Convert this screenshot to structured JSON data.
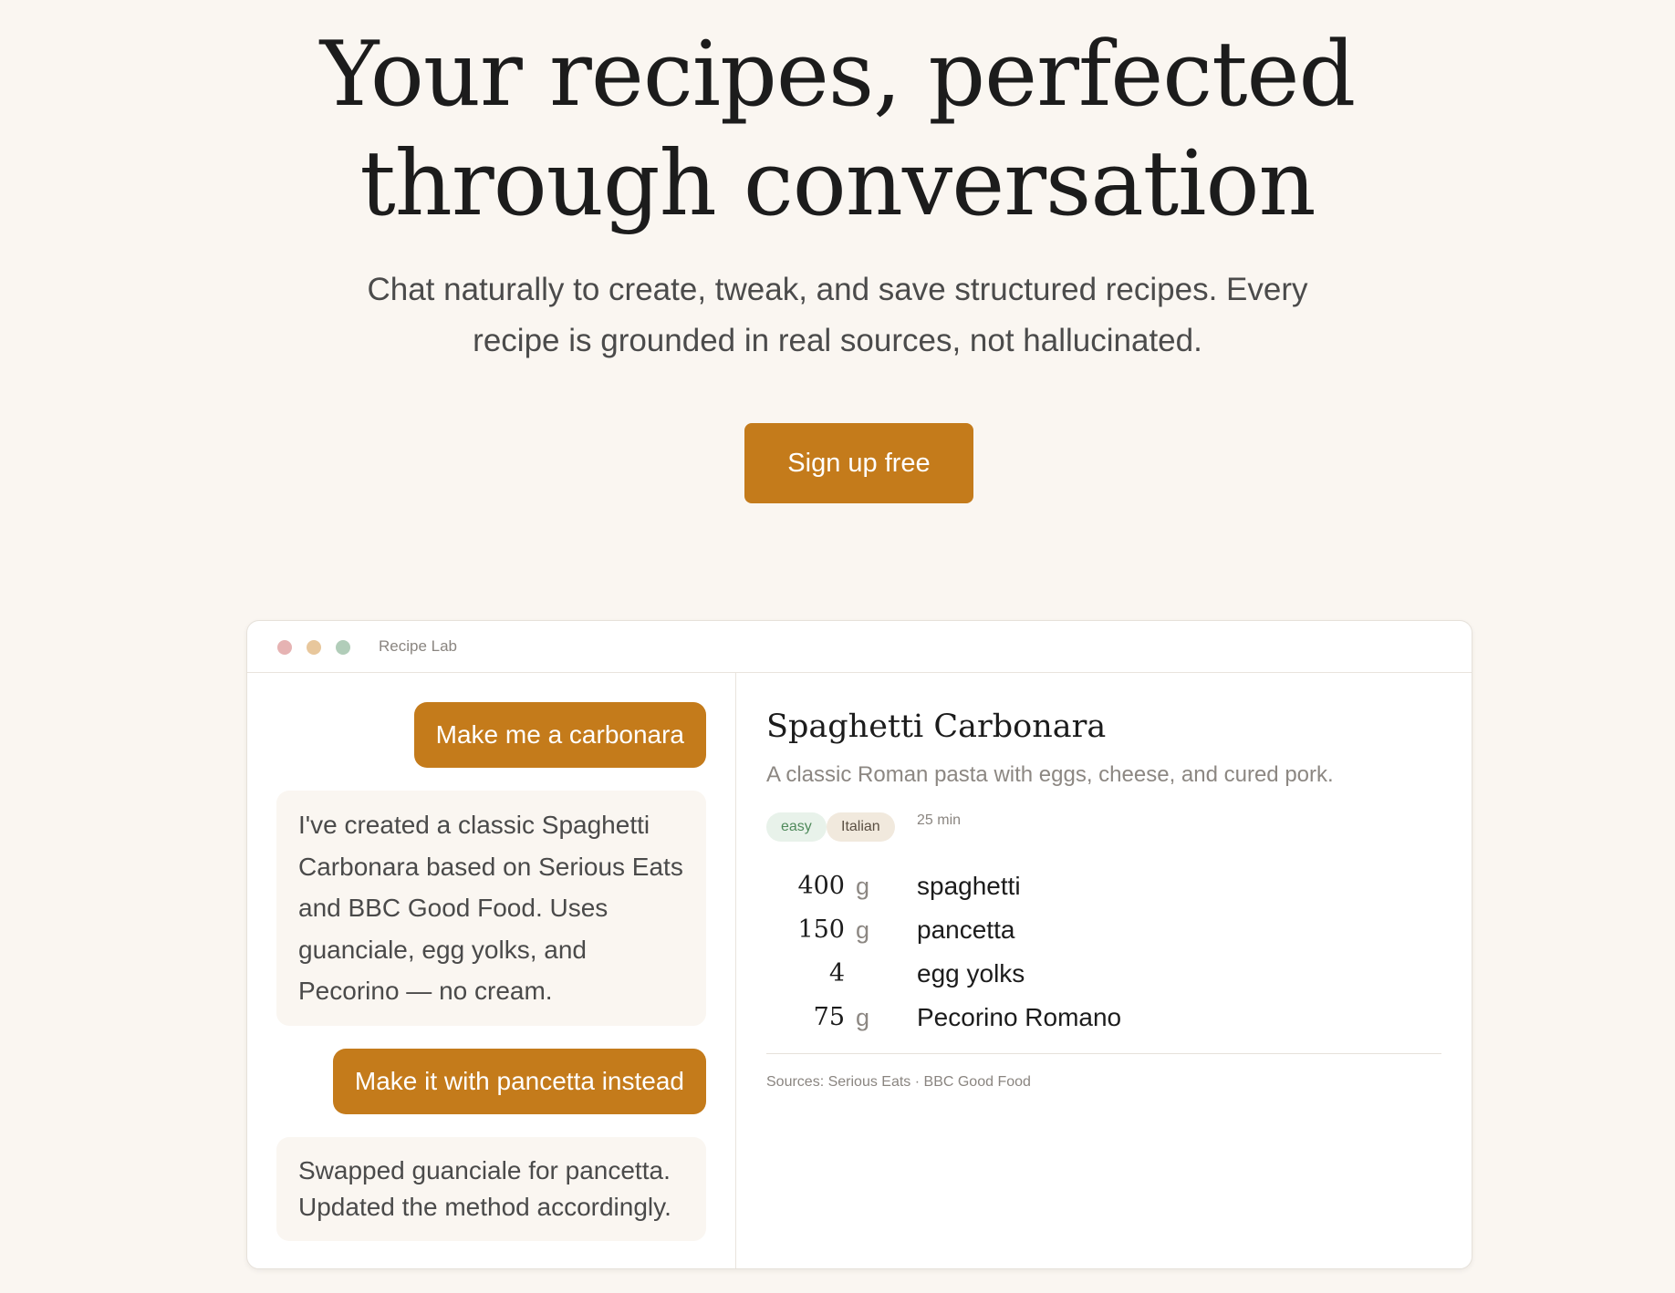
{
  "hero": {
    "title_line1": "Your recipes, perfected",
    "title_line2": "through conversation",
    "subtitle": "Chat naturally to create, tweak, and save structured recipes. Every recipe is grounded in real sources, not hallucinated.",
    "cta_label": "Sign up free"
  },
  "app": {
    "title": "Recipe Lab",
    "chat": [
      {
        "role": "user",
        "text": "Make me a carbonara"
      },
      {
        "role": "assistant",
        "text": "I've created a classic Spaghetti Carbonara based on Serious Eats and BBC Good Food. Uses guanciale, egg yolks, and Pecorino — no cream."
      },
      {
        "role": "user",
        "text": "Make it with pancetta instead"
      },
      {
        "role": "assistant",
        "text": "Swapped guanciale for pancetta. Updated the method accordingly."
      }
    ],
    "recipe": {
      "title": "Spaghetti Carbonara",
      "description": "A classic Roman pasta with eggs, cheese, and cured pork.",
      "tags": [
        "easy",
        "Italian"
      ],
      "time": "25 min",
      "ingredients": [
        {
          "qty": "400",
          "unit": "g",
          "name": "spaghetti"
        },
        {
          "qty": "150",
          "unit": "g",
          "name": "pancetta"
        },
        {
          "qty": "4",
          "unit": "",
          "name": "egg yolks"
        },
        {
          "qty": "75",
          "unit": "g",
          "name": "Pecorino Romano"
        }
      ],
      "sources": "Sources: Serious Eats · BBC Good Food"
    }
  },
  "colors": {
    "accent": "#c47b1b",
    "page_background": "#faf6f1",
    "window_dot_red": "#e6b3b3",
    "window_dot_yellow": "#e8c79c",
    "window_dot_green": "#b1cdb9",
    "tag_easy_bg": "#e8f2ea",
    "tag_cuisine_bg": "#f1e9dd"
  }
}
